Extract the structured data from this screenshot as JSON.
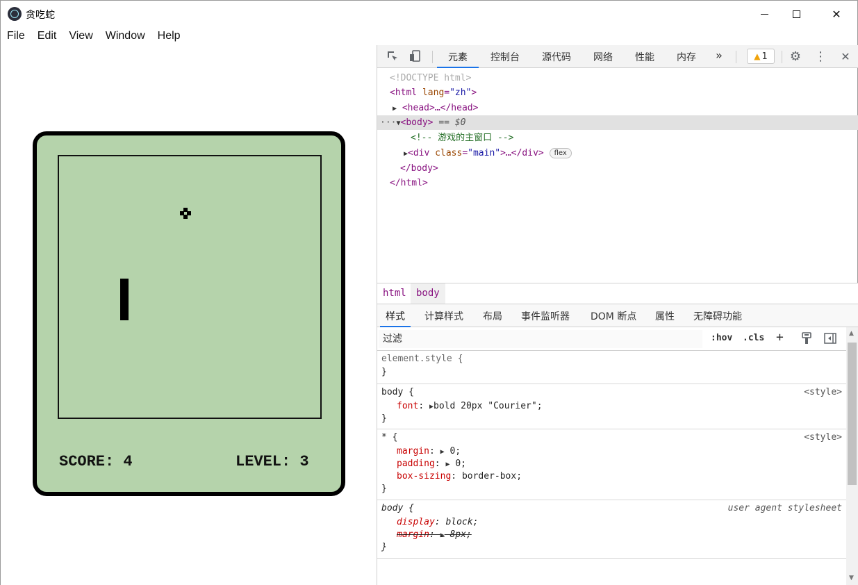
{
  "window": {
    "title": "贪吃蛇"
  },
  "menu": [
    "File",
    "Edit",
    "View",
    "Window",
    "Help"
  ],
  "game": {
    "score_text": "SCORE: 4",
    "level_text": "LEVEL: 3",
    "food_glyph": "⯁"
  },
  "devtools": {
    "tabs": [
      "元素",
      "控制台",
      "源代码",
      "网络",
      "性能",
      "内存"
    ],
    "more": "»",
    "warnings": "1",
    "dom": {
      "doctype": "<!DOCTYPE html>",
      "html_open_tag": "<html",
      "html_attr_name": "lang",
      "html_attr_value": "\"zh\"",
      "head": "<head>…</head>",
      "body_open": "<body>",
      "body_marker": "== $0",
      "comment": "<!-- 游戏的主窗口 -->",
      "div_tag": "<div",
      "div_attr_name": "class",
      "div_attr_value": "\"main\"",
      "div_close": ">…</div>",
      "flex_badge": "flex",
      "body_close": "</body>",
      "html_close": "</html>"
    },
    "breadcrumb": [
      "html",
      "body"
    ],
    "sub_tabs": [
      "样式",
      "计算样式",
      "布局",
      "事件监听器",
      "DOM 断点",
      "属性",
      "无障碍功能"
    ],
    "filter_placeholder": "过滤",
    "filter_buttons": {
      "hov": ":hov",
      "cls": ".cls",
      "add": "+"
    },
    "rules": {
      "element_style": {
        "selector": "element.style {",
        "close": "}"
      },
      "body_style": {
        "selector": "body {",
        "source": "<style>",
        "prop": "font",
        "value": "bold 20px \"Courier\";",
        "close": "}"
      },
      "star_style": {
        "selector": "* {",
        "source": "<style>",
        "p1": "margin",
        "v1": "0;",
        "p2": "padding",
        "v2": "0;",
        "p3": "box-sizing",
        "v3": "border-box;",
        "close": "}"
      },
      "body_ua": {
        "selector": "body {",
        "source": "user agent stylesheet",
        "p1": "display",
        "v1": "block;",
        "p2": "margin",
        "v2": "8px;",
        "close": "}"
      }
    }
  }
}
